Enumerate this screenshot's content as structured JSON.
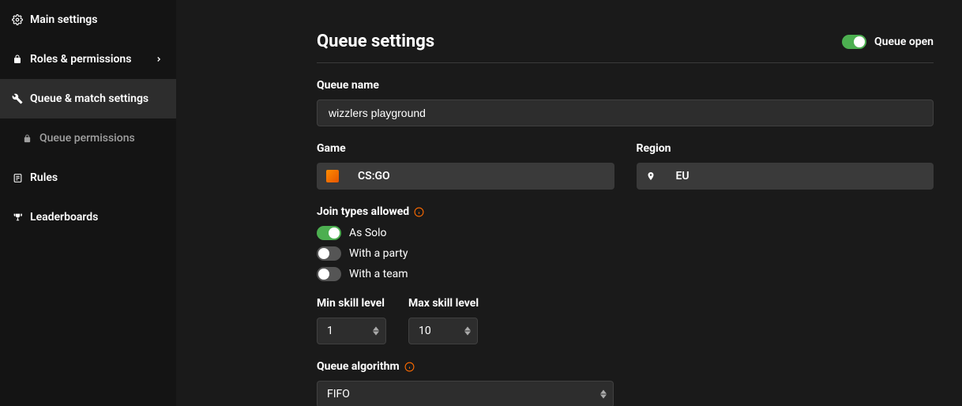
{
  "sidebar": {
    "items": [
      {
        "label": "Main settings"
      },
      {
        "label": "Roles & permissions"
      },
      {
        "label": "Queue & match settings"
      },
      {
        "label": "Queue permissions"
      },
      {
        "label": "Rules"
      },
      {
        "label": "Leaderboards"
      }
    ]
  },
  "header": {
    "title": "Queue settings",
    "queueOpenLabel": "Queue open"
  },
  "form": {
    "queueNameLabel": "Queue name",
    "queueNameValue": "wizzlers playground",
    "gameLabel": "Game",
    "gameValue": "CS:GO",
    "regionLabel": "Region",
    "regionValue": "EU",
    "joinTypesLabel": "Join types allowed",
    "joinTypes": [
      {
        "label": "As Solo",
        "on": true
      },
      {
        "label": "With a party",
        "on": false
      },
      {
        "label": "With a team",
        "on": false
      }
    ],
    "minSkillLabel": "Min skill level",
    "minSkillValue": "1",
    "maxSkillLabel": "Max skill level",
    "maxSkillValue": "10",
    "queueAlgorithmLabel": "Queue algorithm",
    "queueAlgorithmValue": "FIFO"
  }
}
